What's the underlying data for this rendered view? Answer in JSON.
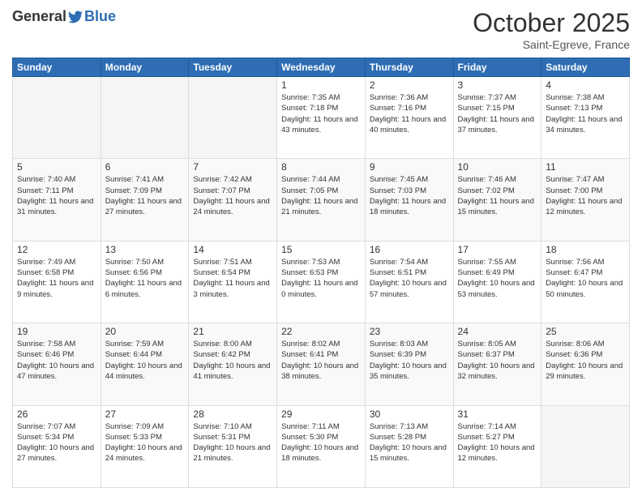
{
  "header": {
    "logo_general": "General",
    "logo_blue": "Blue",
    "month": "October 2025",
    "location": "Saint-Egreve, France"
  },
  "days_of_week": [
    "Sunday",
    "Monday",
    "Tuesday",
    "Wednesday",
    "Thursday",
    "Friday",
    "Saturday"
  ],
  "weeks": [
    [
      {
        "day": "",
        "empty": true
      },
      {
        "day": "",
        "empty": true
      },
      {
        "day": "",
        "empty": true
      },
      {
        "day": "1",
        "sunrise": "7:35 AM",
        "sunset": "7:18 PM",
        "daylight": "11 hours and 43 minutes."
      },
      {
        "day": "2",
        "sunrise": "7:36 AM",
        "sunset": "7:16 PM",
        "daylight": "11 hours and 40 minutes."
      },
      {
        "day": "3",
        "sunrise": "7:37 AM",
        "sunset": "7:15 PM",
        "daylight": "11 hours and 37 minutes."
      },
      {
        "day": "4",
        "sunrise": "7:38 AM",
        "sunset": "7:13 PM",
        "daylight": "11 hours and 34 minutes."
      }
    ],
    [
      {
        "day": "5",
        "sunrise": "7:40 AM",
        "sunset": "7:11 PM",
        "daylight": "11 hours and 31 minutes."
      },
      {
        "day": "6",
        "sunrise": "7:41 AM",
        "sunset": "7:09 PM",
        "daylight": "11 hours and 27 minutes."
      },
      {
        "day": "7",
        "sunrise": "7:42 AM",
        "sunset": "7:07 PM",
        "daylight": "11 hours and 24 minutes."
      },
      {
        "day": "8",
        "sunrise": "7:44 AM",
        "sunset": "7:05 PM",
        "daylight": "11 hours and 21 minutes."
      },
      {
        "day": "9",
        "sunrise": "7:45 AM",
        "sunset": "7:03 PM",
        "daylight": "11 hours and 18 minutes."
      },
      {
        "day": "10",
        "sunrise": "7:46 AM",
        "sunset": "7:02 PM",
        "daylight": "11 hours and 15 minutes."
      },
      {
        "day": "11",
        "sunrise": "7:47 AM",
        "sunset": "7:00 PM",
        "daylight": "11 hours and 12 minutes."
      }
    ],
    [
      {
        "day": "12",
        "sunrise": "7:49 AM",
        "sunset": "6:58 PM",
        "daylight": "11 hours and 9 minutes."
      },
      {
        "day": "13",
        "sunrise": "7:50 AM",
        "sunset": "6:56 PM",
        "daylight": "11 hours and 6 minutes."
      },
      {
        "day": "14",
        "sunrise": "7:51 AM",
        "sunset": "6:54 PM",
        "daylight": "11 hours and 3 minutes."
      },
      {
        "day": "15",
        "sunrise": "7:53 AM",
        "sunset": "6:53 PM",
        "daylight": "11 hours and 0 minutes."
      },
      {
        "day": "16",
        "sunrise": "7:54 AM",
        "sunset": "6:51 PM",
        "daylight": "10 hours and 57 minutes."
      },
      {
        "day": "17",
        "sunrise": "7:55 AM",
        "sunset": "6:49 PM",
        "daylight": "10 hours and 53 minutes."
      },
      {
        "day": "18",
        "sunrise": "7:56 AM",
        "sunset": "6:47 PM",
        "daylight": "10 hours and 50 minutes."
      }
    ],
    [
      {
        "day": "19",
        "sunrise": "7:58 AM",
        "sunset": "6:46 PM",
        "daylight": "10 hours and 47 minutes."
      },
      {
        "day": "20",
        "sunrise": "7:59 AM",
        "sunset": "6:44 PM",
        "daylight": "10 hours and 44 minutes."
      },
      {
        "day": "21",
        "sunrise": "8:00 AM",
        "sunset": "6:42 PM",
        "daylight": "10 hours and 41 minutes."
      },
      {
        "day": "22",
        "sunrise": "8:02 AM",
        "sunset": "6:41 PM",
        "daylight": "10 hours and 38 minutes."
      },
      {
        "day": "23",
        "sunrise": "8:03 AM",
        "sunset": "6:39 PM",
        "daylight": "10 hours and 35 minutes."
      },
      {
        "day": "24",
        "sunrise": "8:05 AM",
        "sunset": "6:37 PM",
        "daylight": "10 hours and 32 minutes."
      },
      {
        "day": "25",
        "sunrise": "8:06 AM",
        "sunset": "6:36 PM",
        "daylight": "10 hours and 29 minutes."
      }
    ],
    [
      {
        "day": "26",
        "sunrise": "7:07 AM",
        "sunset": "5:34 PM",
        "daylight": "10 hours and 27 minutes."
      },
      {
        "day": "27",
        "sunrise": "7:09 AM",
        "sunset": "5:33 PM",
        "daylight": "10 hours and 24 minutes."
      },
      {
        "day": "28",
        "sunrise": "7:10 AM",
        "sunset": "5:31 PM",
        "daylight": "10 hours and 21 minutes."
      },
      {
        "day": "29",
        "sunrise": "7:11 AM",
        "sunset": "5:30 PM",
        "daylight": "10 hours and 18 minutes."
      },
      {
        "day": "30",
        "sunrise": "7:13 AM",
        "sunset": "5:28 PM",
        "daylight": "10 hours and 15 minutes."
      },
      {
        "day": "31",
        "sunrise": "7:14 AM",
        "sunset": "5:27 PM",
        "daylight": "10 hours and 12 minutes."
      },
      {
        "day": "",
        "empty": true
      }
    ]
  ]
}
